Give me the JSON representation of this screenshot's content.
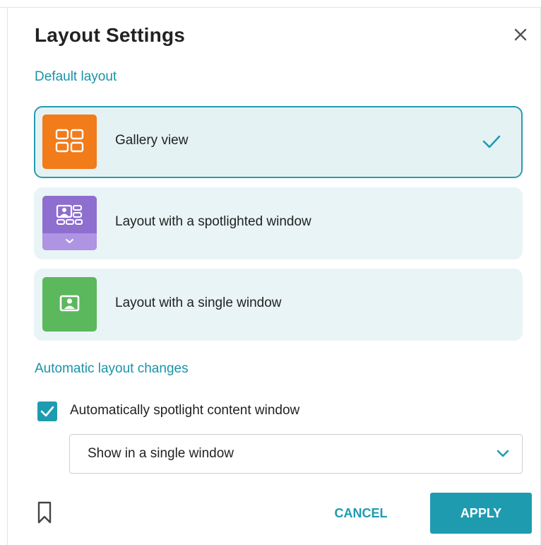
{
  "dialog": {
    "title": "Layout Settings",
    "close_icon": "close-icon"
  },
  "default_layout": {
    "heading": "Default layout",
    "options": [
      {
        "label": "Gallery view",
        "icon": "gallery-grid-icon",
        "icon_color": "#f27b1a",
        "selected": true
      },
      {
        "label": "Layout with a spotlighted window",
        "icon": "spotlight-layout-icon",
        "icon_color": "#8e6fd0",
        "selected": false
      },
      {
        "label": "Layout with a single window",
        "icon": "single-window-icon",
        "icon_color": "#5cb85c",
        "selected": false
      }
    ]
  },
  "automatic_layout": {
    "heading": "Automatic layout changes",
    "checkbox": {
      "label": "Automatically spotlight content window",
      "checked": true
    },
    "select": {
      "value": "Show in a single window"
    }
  },
  "footer": {
    "bookmark_icon": "bookmark-icon",
    "cancel_label": "CANCEL",
    "apply_label": "APPLY"
  },
  "colors": {
    "accent": "#1f9bb0",
    "card_background": "#e9f4f6"
  }
}
